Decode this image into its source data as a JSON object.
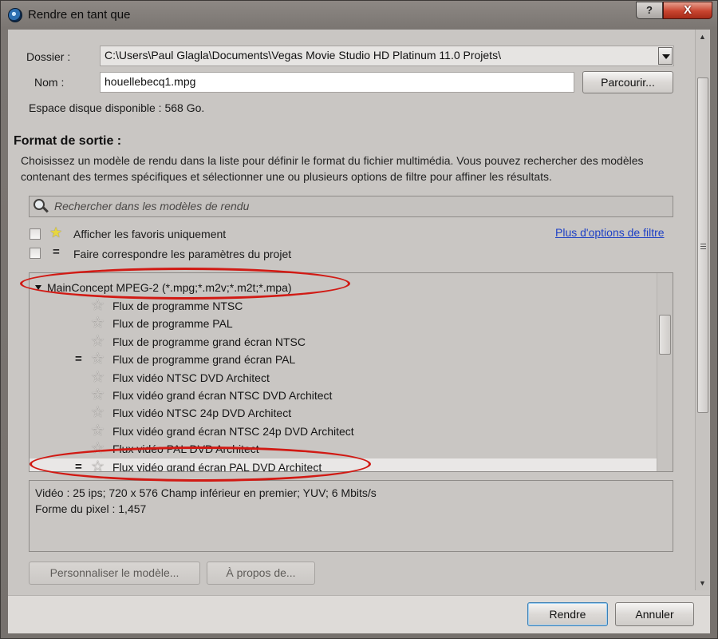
{
  "window": {
    "title": "Rendre en tant que",
    "help_button": "?",
    "close_button": "X"
  },
  "location": {
    "folder_label": "Dossier :",
    "folder_value": "C:\\Users\\Paul Glagla\\Documents\\Vegas Movie Studio HD Platinum 11.0 Projets\\",
    "name_label": "Nom :",
    "name_value": "houellebecq1.mpg",
    "browse_button": "Parcourir...",
    "disk_space": "Espace disque disponible : 568 Go."
  },
  "output_format": {
    "title": "Format de sortie :",
    "description": "Choisissez un modèle de rendu dans la liste pour définir le format du fichier multimédia. Vous pouvez rechercher des modèles contenant des termes spécifiques et sélectionner une ou plusieurs options de filtre pour affiner les résultats.",
    "search_placeholder": "Rechercher dans les modèles de rendu",
    "favorites_only_label": "Afficher les favoris uniquement",
    "match_project_label": "Faire correspondre les paramètres du projet",
    "more_filters_link": "Plus d'options de filtre"
  },
  "template_tree": {
    "group": "MainConcept MPEG-2 (*.mpg;*.m2v;*.m2t;*.mpa)",
    "items": [
      {
        "label": "Flux de programme NTSC",
        "match": ""
      },
      {
        "label": "Flux de programme PAL",
        "match": ""
      },
      {
        "label": "Flux de programme grand écran NTSC",
        "match": ""
      },
      {
        "label": "Flux de programme grand écran PAL",
        "match": "="
      },
      {
        "label": "Flux vidéo NTSC DVD Architect",
        "match": ""
      },
      {
        "label": "Flux vidéo grand écran NTSC DVD Architect",
        "match": ""
      },
      {
        "label": "Flux vidéo NTSC 24p DVD Architect",
        "match": ""
      },
      {
        "label": "Flux vidéo grand écran NTSC 24p DVD Architect",
        "match": ""
      },
      {
        "label": "Flux vidéo PAL DVD Architect",
        "match": ""
      },
      {
        "label": "Flux vidéo grand écran PAL DVD Architect",
        "match": "=",
        "selected": true
      }
    ]
  },
  "details": {
    "line1": "Vidéo : 25 ips; 720 x 576 Champ inférieur en premier; YUV; 6 Mbits/s",
    "line2": "Forme du pixel : 1,457"
  },
  "actions": {
    "customize_button": "Personnaliser le modèle...",
    "about_button": "À propos de...",
    "render_button": "Rendre",
    "cancel_button": "Annuler"
  },
  "colors": {
    "annotation_red": "#d11a14",
    "link_blue": "#1f41c5",
    "favorite_star": "#e7d640"
  }
}
